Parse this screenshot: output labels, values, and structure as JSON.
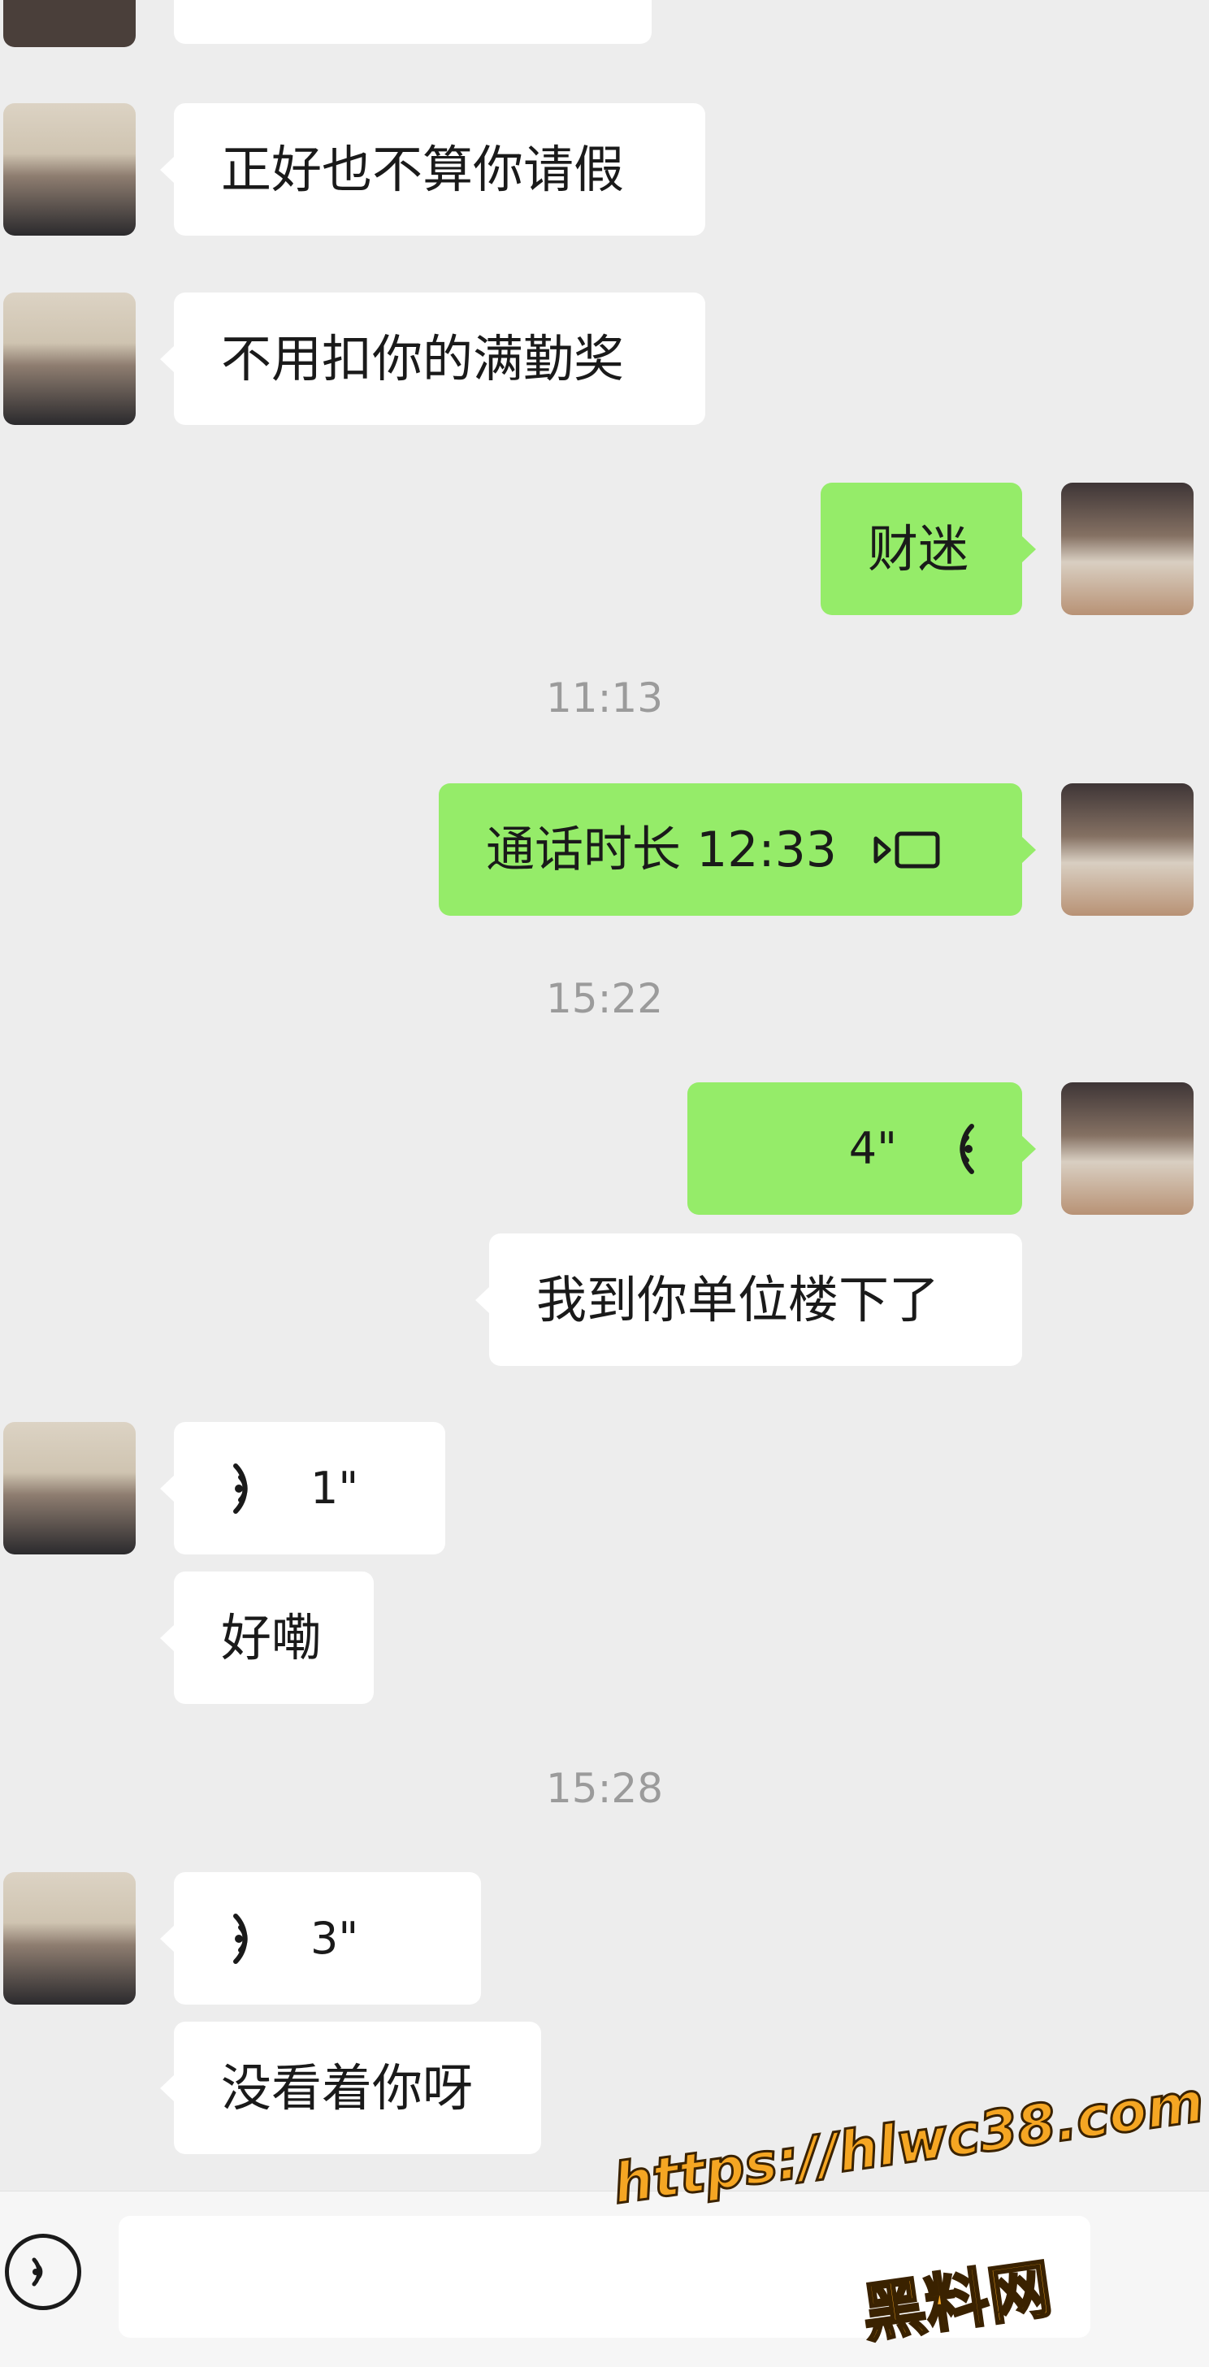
{
  "messages": {
    "in1": "正好也不算你请假",
    "in2": "不用扣你的满勤奖",
    "out1": "财迷",
    "time1": "11:13",
    "call_label": "通话时长 12:33",
    "time2": "15:22",
    "out_voice_dur": "4\"",
    "out2": "我到你单位楼下了",
    "in_voice1_dur": "1\"",
    "in3": "好嘞",
    "time3": "15:28",
    "in_voice2_dur": "3\"",
    "in4": "没看着你呀"
  },
  "watermark": {
    "url": "https://hlwc38.com",
    "name": "黑料网"
  },
  "colors": {
    "outgoing_bubble": "#95ec69",
    "incoming_bubble": "#ffffff",
    "background": "#ededed",
    "timestamp": "#9b9b9b"
  },
  "icons": [
    "voice-wave-icon",
    "video-call-icon",
    "voice-input-icon"
  ]
}
